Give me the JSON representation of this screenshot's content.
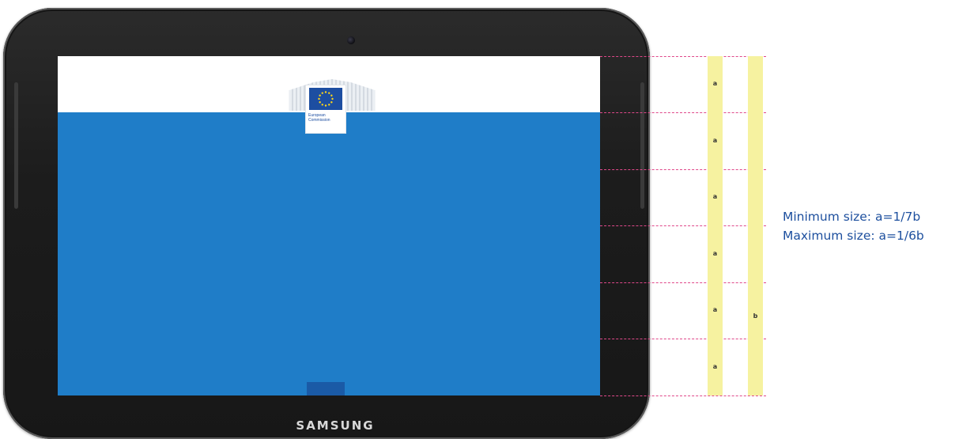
{
  "device": {
    "brand": "SAMSUNG"
  },
  "logo": {
    "line1": "European",
    "line2": "Commission",
    "flag_color": "#1d4ea1",
    "star_color": "#ffd617"
  },
  "screen": {
    "header_color": "#ffffff",
    "body_color": "#1f7dc8"
  },
  "annotation": {
    "segment_labels": [
      "a",
      "a",
      "a",
      "a",
      "a",
      "a"
    ],
    "total_label": "b",
    "min_rule": "Minimum size: a=1/7b",
    "max_rule": "Maximum size: a=1/6b",
    "guide_color": "#e0488a",
    "bar_color": "#f6f2a0"
  }
}
